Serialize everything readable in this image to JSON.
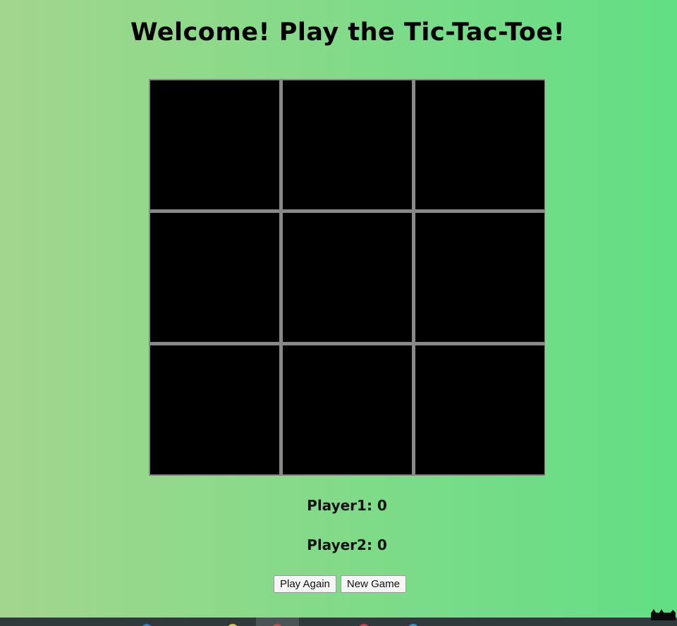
{
  "title": "Welcome! Play the Tic-Tac-Toe!",
  "board": {
    "rows": 3,
    "cols": 3,
    "cells": [
      "",
      "",
      "",
      "",
      "",
      "",
      "",
      "",
      ""
    ]
  },
  "scores": {
    "player1": "Player1: 0",
    "player2": "Player2: 0"
  },
  "buttons": {
    "play_again": "Play Again",
    "new_game": "New Game"
  },
  "colors": {
    "cell": "#000000",
    "grid_lines": "#888888",
    "background_start": "#a3d68c",
    "background_end": "#62de84"
  },
  "taskbar": {
    "icons": [
      "blue-app-icon",
      "yellow-app-icon",
      "red-app-icon",
      "blue-browser-icon"
    ]
  }
}
